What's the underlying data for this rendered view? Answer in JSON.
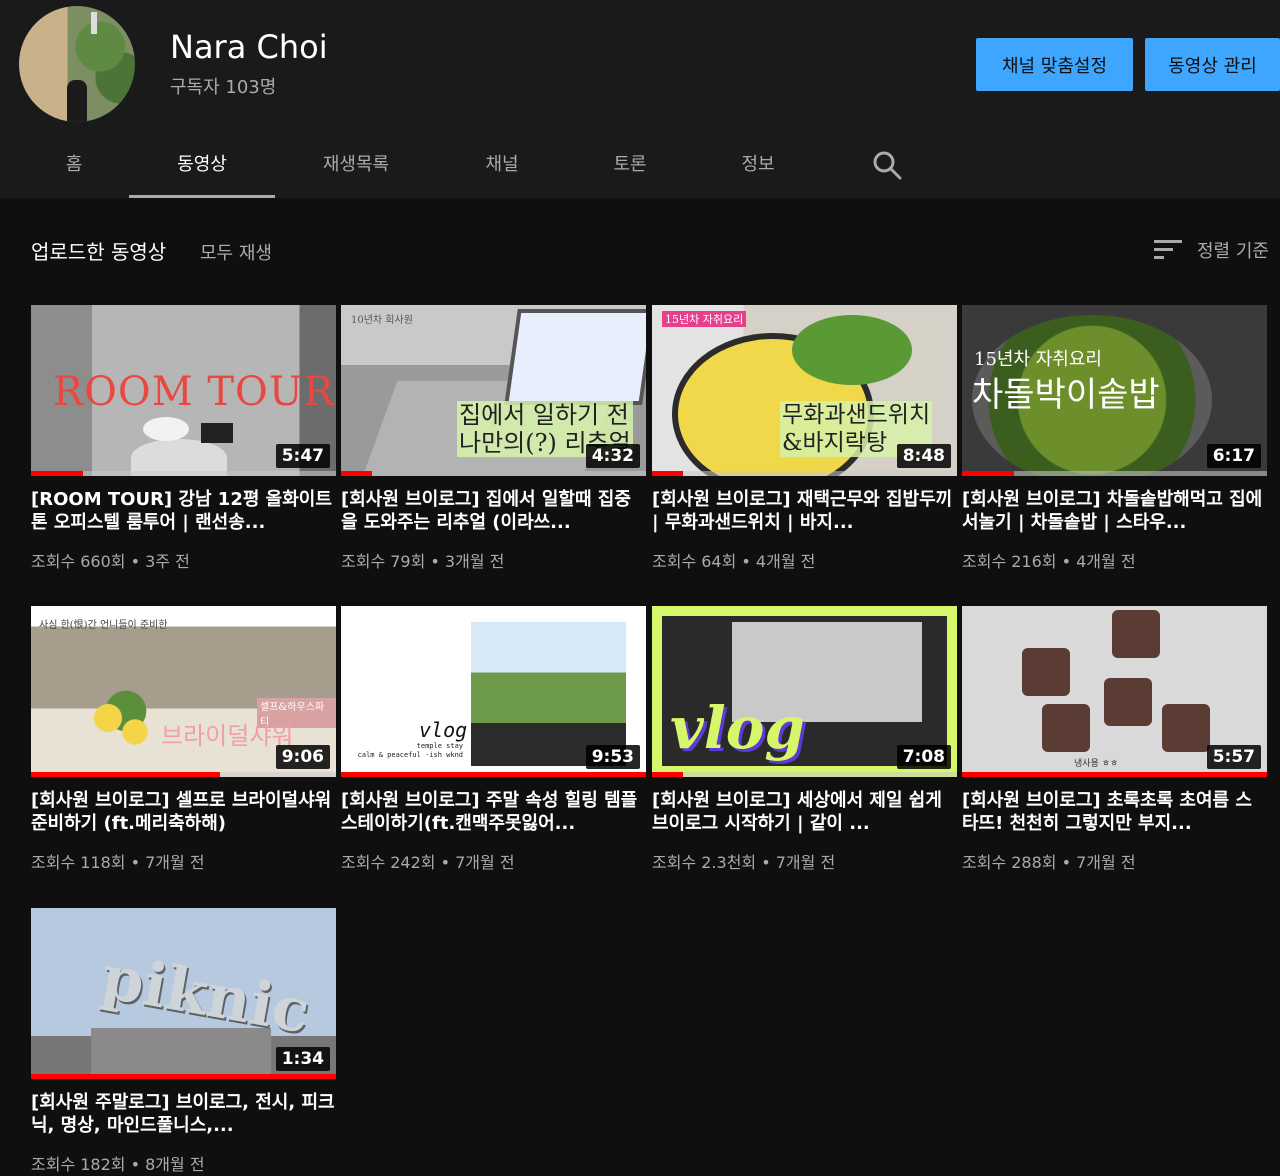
{
  "channel": {
    "name": "Nara Choi",
    "subscribers": "구독자 103명",
    "customize_label": "채널 맞춤설정",
    "manage_label": "동영상 관리"
  },
  "tabs": [
    {
      "label": "홈"
    },
    {
      "label": "동영상"
    },
    {
      "label": "재생목록"
    },
    {
      "label": "채널"
    },
    {
      "label": "토론"
    },
    {
      "label": "정보"
    }
  ],
  "active_tab": "동영상",
  "section": {
    "title": "업로드한 동영상",
    "play_all": "모두 재생",
    "sort_label": "정렬 기준"
  },
  "videos": [
    {
      "title": "[ROOM TOUR] 강남 12평 올화이트톤 오피스텔 룸투어 | 랜선송...",
      "meta": "조회수 660회 • 3주 전",
      "duration": "5:47",
      "progress": 0.17,
      "thumb_text": "ROOM TOUR"
    },
    {
      "title": "[회사원 브이로그] 집에서 일할때 집중을 도와주는 리추얼 (이라쓰...",
      "meta": "조회수 79회 • 3개월 전",
      "duration": "4:32",
      "progress": 0.1,
      "thumb_text": "집에서 일하기 전\n나만의(?) 리추얼",
      "thumb_caption": "10년차 회사원"
    },
    {
      "title": "[회사원 브이로그] 재택근무와 집밥두끼 | 무화과샌드위치 | 바지...",
      "meta": "조회수 64회 • 4개월 전",
      "duration": "8:48",
      "progress": 0.1,
      "thumb_text": "무화과샌드위치\n&바지락탕",
      "thumb_caption": "15년차 자취요리"
    },
    {
      "title": "[회사원 브이로그] 차돌솥밥해먹고 집에서놀기 | 차돌솥밥 | 스타우...",
      "meta": "조회수 216회 • 4개월 전",
      "duration": "6:17",
      "progress": 0.17,
      "thumb_text": "차돌박이솥밥",
      "thumb_caption": "15년차 자취요리"
    },
    {
      "title": "[회사원 브이로그] 셀프로 브라이덜샤워 준비하기 (ft.메리축하해)",
      "meta": "조회수 118회 • 7개월 전",
      "duration": "9:06",
      "progress": 0.62,
      "thumb_text": "브라이덜샤워",
      "thumb_caption": "사심 한(恨)간 언니들이 준비한",
      "thumb_badge": "셀프&하우스파티"
    },
    {
      "title": "[회사원 브이로그] 주말 속성 힐링 템플스테이하기(ft.캔맥주못잃어...",
      "meta": "조회수 242회 • 7개월 전",
      "duration": "9:53",
      "progress": 1.0,
      "thumb_text": "vlog",
      "thumb_caption": "temple stay\ncalm & peaceful -ish wknd"
    },
    {
      "title": "[회사원 브이로그] 세상에서 제일 쉽게 브이로그 시작하기 | 같이 ...",
      "meta": "조회수 2.3천회 • 7개월 전",
      "duration": "7:08",
      "progress": 0.1,
      "thumb_text": "vlog"
    },
    {
      "title": "[회사원 브이로그] 초록초록 초여름 스타뜨! 천천히 그렇지만 부지...",
      "meta": "조회수 288회 • 7개월 전",
      "duration": "5:57",
      "progress": 1.0,
      "thumb_text": "",
      "thumb_caption": "냉사용 ㅎㅎ"
    },
    {
      "title": "[회사원 주말로그] 브이로그, 전시, 피크닉, 명상, 마인드풀니스,...",
      "meta": "조회수 182회 • 8개월 전",
      "duration": "1:34",
      "progress": 1.0,
      "thumb_text": "piknic"
    }
  ],
  "colors": {
    "accent": "#3ea6ff",
    "progress": "#ff0000",
    "background": "#0f0f0f",
    "header": "#1a1a1a"
  },
  "icons": {
    "search": "search-icon",
    "sort": "sort-icon"
  }
}
